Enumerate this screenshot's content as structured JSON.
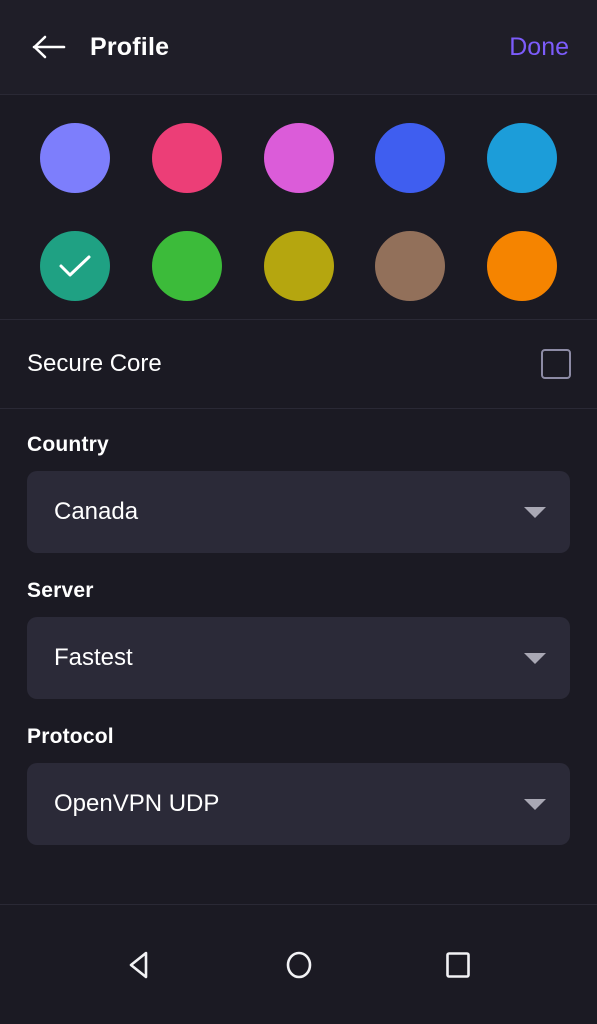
{
  "header": {
    "back_icon": "arrow-left-icon",
    "title": "Profile",
    "action_label": "Done",
    "action_color": "#7c5cfb"
  },
  "colors": {
    "selected_index": 5,
    "check_icon": "check-icon",
    "swatches": [
      {
        "name": "periwinkle",
        "hex": "#7d7efc",
        "selected": false
      },
      {
        "name": "pink",
        "hex": "#ec3e77",
        "selected": false
      },
      {
        "name": "orchid",
        "hex": "#db5cd9",
        "selected": false
      },
      {
        "name": "royal-blue",
        "hex": "#3f5ef0",
        "selected": false
      },
      {
        "name": "cyan-blue",
        "hex": "#1c9dd9",
        "selected": false
      },
      {
        "name": "teal-green",
        "hex": "#1fa183",
        "selected": true
      },
      {
        "name": "green",
        "hex": "#3cbb3a",
        "selected": false
      },
      {
        "name": "olive",
        "hex": "#b5a60f",
        "selected": false
      },
      {
        "name": "brown",
        "hex": "#92705a",
        "selected": false
      },
      {
        "name": "orange",
        "hex": "#f58400",
        "selected": false
      }
    ]
  },
  "secure_core": {
    "label": "Secure Core",
    "checked": false
  },
  "fields": [
    {
      "label": "Country",
      "value": "Canada",
      "caret_icon": "chevron-down-icon"
    },
    {
      "label": "Server",
      "value": "Fastest",
      "caret_icon": "chevron-down-icon"
    },
    {
      "label": "Protocol",
      "value": "OpenVPN UDP",
      "caret_icon": "chevron-down-icon"
    }
  ],
  "navbar": {
    "back_icon": "triangle-back-icon",
    "home_icon": "circle-home-icon",
    "recents_icon": "square-recents-icon"
  }
}
